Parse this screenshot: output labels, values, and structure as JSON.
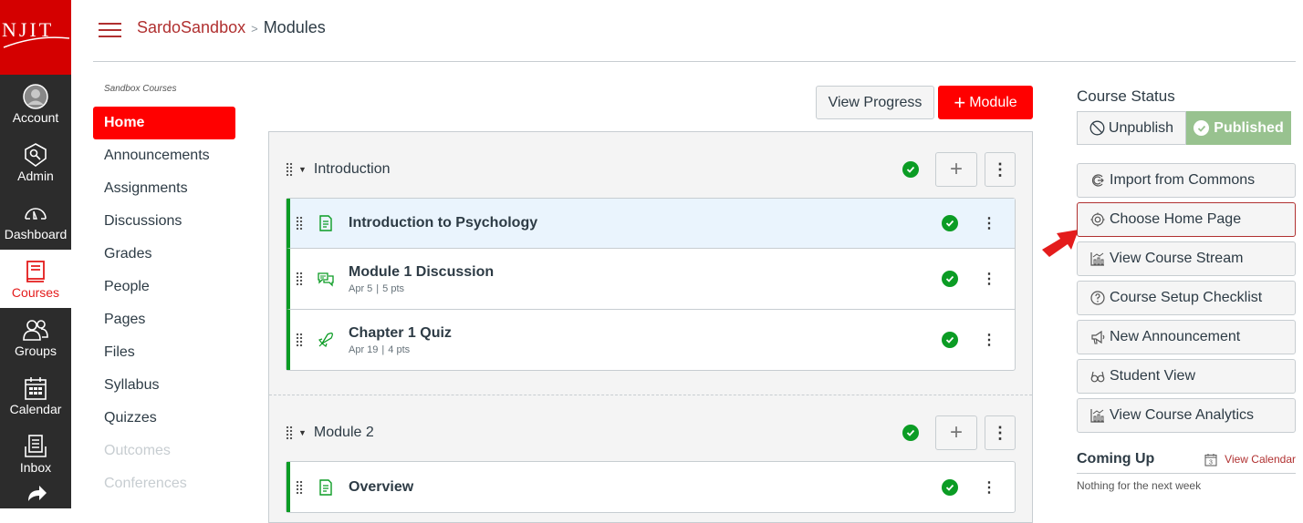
{
  "global_nav": {
    "logo_text": "NJIT",
    "items": [
      {
        "label": "Account",
        "icon": "avatar-icon"
      },
      {
        "label": "Admin",
        "icon": "admin-shield-icon"
      },
      {
        "label": "Dashboard",
        "icon": "dashboard-gauge-icon"
      },
      {
        "label": "Courses",
        "icon": "book-icon",
        "active": true
      },
      {
        "label": "Groups",
        "icon": "groups-icon"
      },
      {
        "label": "Calendar",
        "icon": "calendar-icon"
      },
      {
        "label": "Inbox",
        "icon": "inbox-icon"
      }
    ]
  },
  "breadcrumb": {
    "course": "SardoSandbox",
    "separator": ">",
    "page": "Modules"
  },
  "course_nav": {
    "subtitle": "Sandbox Courses",
    "items": [
      {
        "label": "Home",
        "active": true
      },
      {
        "label": "Announcements"
      },
      {
        "label": "Assignments"
      },
      {
        "label": "Discussions"
      },
      {
        "label": "Grades"
      },
      {
        "label": "People"
      },
      {
        "label": "Pages"
      },
      {
        "label": "Files"
      },
      {
        "label": "Syllabus"
      },
      {
        "label": "Quizzes"
      },
      {
        "label": "Outcomes",
        "disabled": true
      },
      {
        "label": "Conferences",
        "disabled": true
      }
    ]
  },
  "toolbar": {
    "view_progress": "View Progress",
    "add_module_plus": "+",
    "add_module": "Module"
  },
  "modules": [
    {
      "title": "Introduction",
      "published": true,
      "items": [
        {
          "title": "Introduction to Psychology",
          "type": "page",
          "meta_date": "",
          "meta_pts": "",
          "published": true,
          "highlighted": true
        },
        {
          "title": "Module 1 Discussion",
          "type": "discussion",
          "meta_date": "Apr 5",
          "meta_pts": "5 pts",
          "published": true
        },
        {
          "title": "Chapter 1 Quiz",
          "type": "quiz",
          "meta_date": "Apr 19",
          "meta_pts": "4 pts",
          "published": true
        }
      ]
    },
    {
      "title": "Module 2",
      "published": true,
      "items": [
        {
          "title": "Overview",
          "type": "page",
          "published": true
        }
      ]
    }
  ],
  "sidebar": {
    "course_status_title": "Course Status",
    "unpublish_label": "Unpublish",
    "published_label": "Published",
    "buttons": [
      {
        "label": "Import from Commons",
        "icon": "commons-icon"
      },
      {
        "label": "Choose Home Page",
        "icon": "target-icon",
        "focused": true
      },
      {
        "label": "View Course Stream",
        "icon": "stream-chart-icon"
      },
      {
        "label": "Course Setup Checklist",
        "icon": "question-icon"
      },
      {
        "label": "New Announcement",
        "icon": "megaphone-icon"
      },
      {
        "label": "Student View",
        "icon": "glasses-icon"
      },
      {
        "label": "View Course Analytics",
        "icon": "analytics-chart-icon"
      }
    ],
    "coming_up_title": "Coming Up",
    "view_calendar": "View Calendar",
    "calendar_day": "3",
    "nothing_text": "Nothing for the next week"
  },
  "colors": {
    "brand_red": "#d40000",
    "accent_red": "#ff0000",
    "published_green": "#0b9c24",
    "published_button": "#98c28f"
  }
}
